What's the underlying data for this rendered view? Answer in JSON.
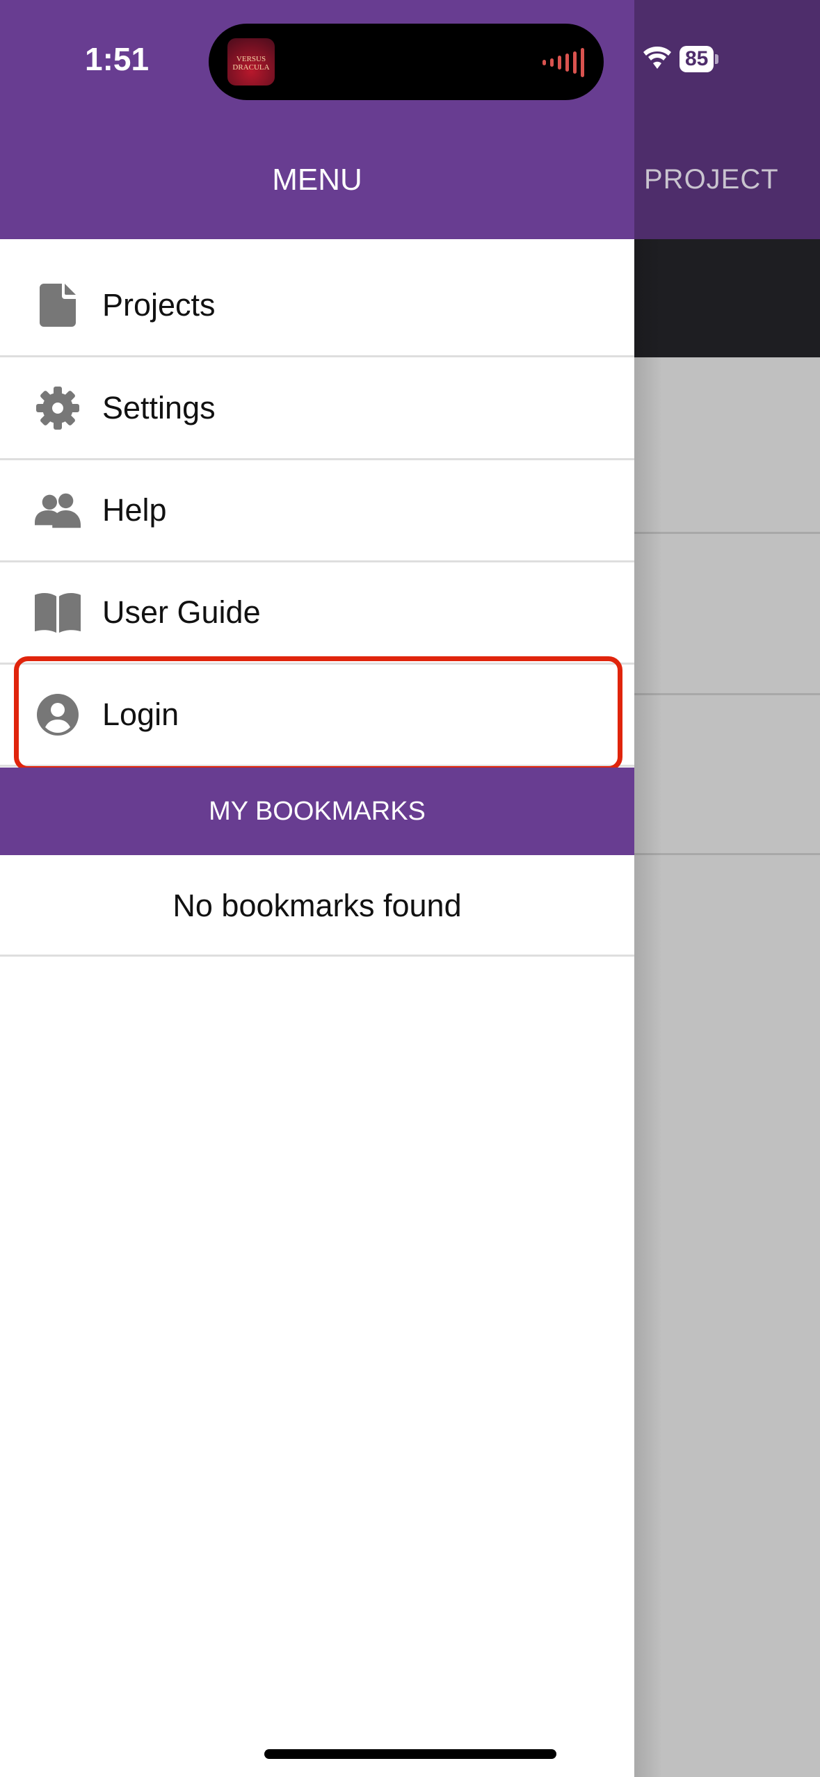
{
  "status_bar": {
    "time": "1:51",
    "battery": "85",
    "live_activity_app": "VERSUS DRACULA"
  },
  "background_screen": {
    "title": "PROJECT"
  },
  "drawer": {
    "title": "MENU",
    "items": [
      {
        "label": "Projects",
        "icon": "file-icon"
      },
      {
        "label": "Settings",
        "icon": "gear-icon"
      },
      {
        "label": "Help",
        "icon": "users-icon"
      },
      {
        "label": "User Guide",
        "icon": "book-icon"
      },
      {
        "label": "Login",
        "icon": "user-circle-icon",
        "highlighted": true
      }
    ],
    "bookmarks_header": "MY BOOKMARKS",
    "bookmarks_empty": "No bookmarks found"
  },
  "colors": {
    "header": "#683d91",
    "highlight": "#e0240c",
    "icon": "#777777"
  }
}
